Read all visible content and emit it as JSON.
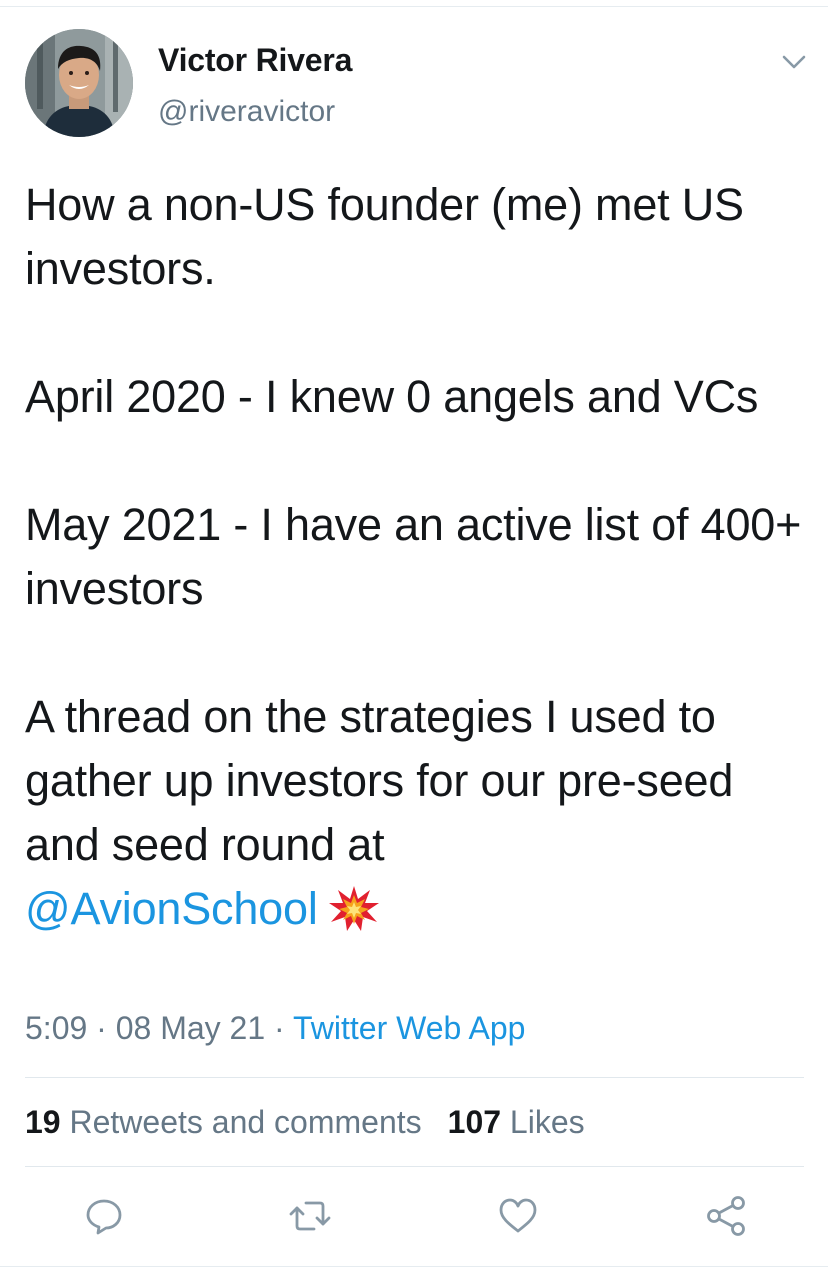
{
  "author": {
    "display_name": "Victor Rivera",
    "handle": "@riveravictor"
  },
  "tweet": {
    "paragraphs": [
      "How a non-US founder (me) met US investors.",
      "April 2020 - I knew 0 angels and VCs",
      "May 2021 - I have an active list of 400+ investors",
      "A thread on the strategies I used to gather up investors for our pre-seed and seed round at"
    ],
    "mention": "@AvionSchool",
    "emoji": "collision-emoji"
  },
  "meta": {
    "time": "5:09",
    "separator": "·",
    "date": "08 May 21",
    "source": "Twitter Web App"
  },
  "stats": {
    "retweets_count": "19",
    "retweets_label": "Retweets and comments",
    "likes_count": "107",
    "likes_label": "Likes"
  },
  "actions": [
    "reply-icon",
    "retweet-icon",
    "like-icon",
    "share-icon"
  ],
  "colors": {
    "text": "#14171a",
    "secondary": "#657786",
    "link": "#1b95e0",
    "divider": "#e1e8ed"
  }
}
